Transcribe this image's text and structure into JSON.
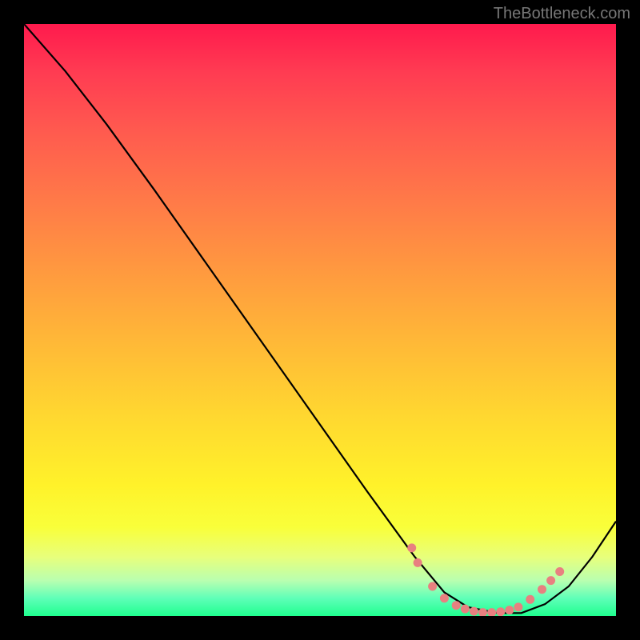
{
  "attribution": "TheBottleneck.com",
  "chart_data": {
    "type": "line",
    "title": "",
    "xlabel": "",
    "ylabel": "",
    "xlim": [
      0,
      1
    ],
    "ylim": [
      0,
      1
    ],
    "series": [
      {
        "name": "curve",
        "x": [
          0.0,
          0.07,
          0.14,
          0.22,
          0.34,
          0.46,
          0.58,
          0.66,
          0.71,
          0.75,
          0.8,
          0.84,
          0.88,
          0.92,
          0.96,
          1.0
        ],
        "y": [
          1.0,
          0.92,
          0.83,
          0.72,
          0.55,
          0.38,
          0.21,
          0.1,
          0.04,
          0.015,
          0.005,
          0.005,
          0.02,
          0.05,
          0.1,
          0.16
        ]
      }
    ],
    "markers": {
      "name": "highlight-dots",
      "x": [
        0.655,
        0.665,
        0.69,
        0.71,
        0.73,
        0.745,
        0.76,
        0.775,
        0.79,
        0.805,
        0.82,
        0.835,
        0.855,
        0.875,
        0.89,
        0.905
      ],
      "y": [
        0.115,
        0.09,
        0.05,
        0.03,
        0.018,
        0.012,
        0.008,
        0.006,
        0.006,
        0.007,
        0.01,
        0.015,
        0.028,
        0.045,
        0.06,
        0.075
      ],
      "color": "#e88080"
    },
    "background_gradient": {
      "top": "#ff1a4d",
      "bottom": "#1fff8f"
    }
  }
}
